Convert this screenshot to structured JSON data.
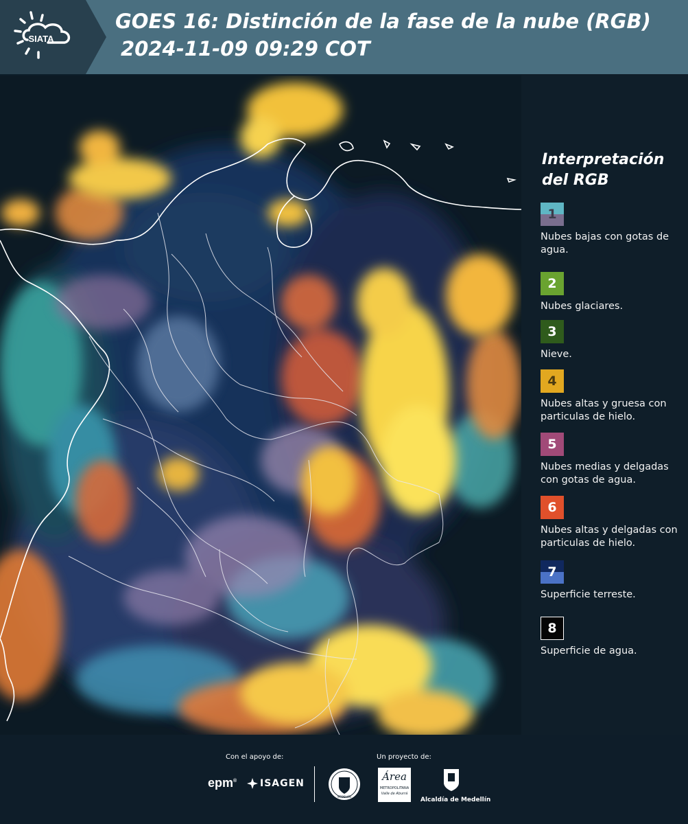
{
  "header": {
    "brand": "SIATA",
    "title_line1": "GOES 16: Distinción de la fase de la nube (RGB)",
    "title_line2": "2024-11-09 09:29 COT"
  },
  "legend": {
    "title": "Interpretación del RGB",
    "items": [
      {
        "number": "1",
        "label": "Nubes bajas con gotas de agua.",
        "color_top": "#5fb6c4",
        "color_bottom": "#7a6e8e"
      },
      {
        "number": "2",
        "label": "Nubes glaciares.",
        "color_top": "#6aa330",
        "color_bottom": "#6aa330"
      },
      {
        "number": "3",
        "label": "Nieve.",
        "color_top": "#2f5b1c",
        "color_bottom": "#2f5b1c"
      },
      {
        "number": "4",
        "label": "Nubes altas y gruesa con particulas de hielo.",
        "color_top": "#e2a820",
        "color_bottom": "#e2a820"
      },
      {
        "number": "5",
        "label": "Nubes medias y delgadas con gotas de agua.",
        "color_top": "#a14a78",
        "color_bottom": "#a14a78"
      },
      {
        "number": "6",
        "label": "Nubes altas y delgadas con particulas de hielo.",
        "color_top": "#e0502b",
        "color_bottom": "#e0502b"
      },
      {
        "number": "7",
        "label": "Superficie terreste.",
        "color_top": "#10285e",
        "color_bottom": "#4b72c6"
      },
      {
        "number": "8",
        "label": "Superficie de agua.",
        "color_top": "#050505",
        "color_bottom": "#050505"
      }
    ]
  },
  "footer": {
    "support_label": "Con el apoyo de:",
    "project_label": "Un proyecto de:",
    "sponsor1": "epm",
    "sponsor2": "ISAGEN",
    "partner1_text": "MEDELLÍN",
    "partner2_text": "Área",
    "partner2_sub1": "METROPOLITANA",
    "partner2_sub2": "Valle de Aburrá",
    "partner3": "Alcaldía de Medellín"
  },
  "colors": {
    "header_bg": "#4a6f80",
    "sidebar_bg": "#0f1e29",
    "footer_bg": "#0e1d29"
  }
}
